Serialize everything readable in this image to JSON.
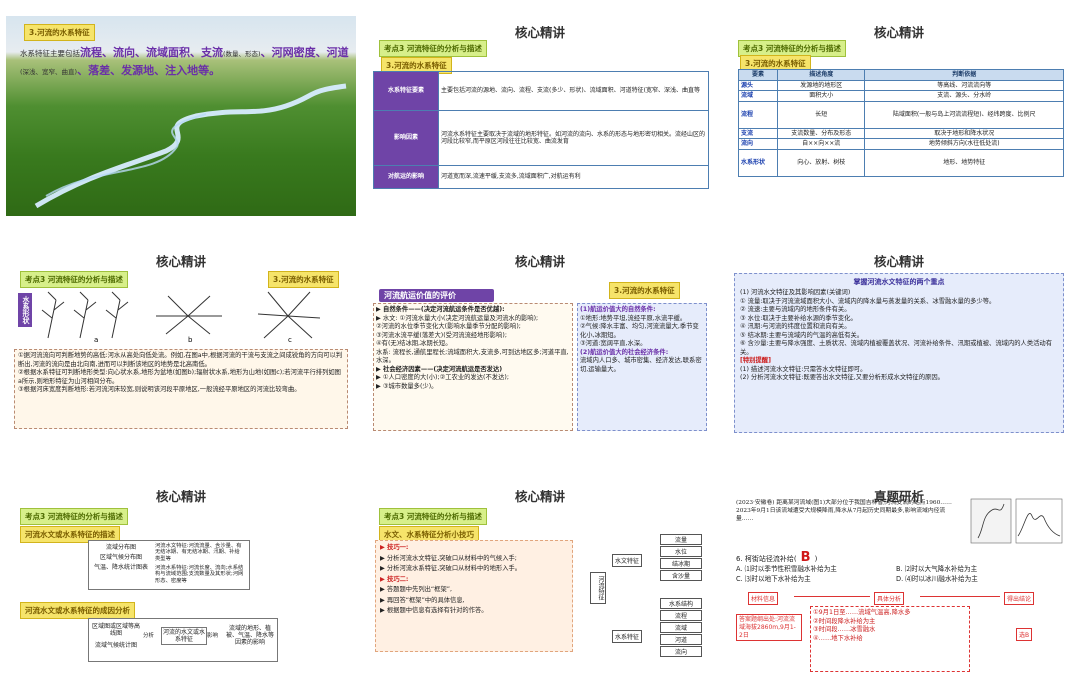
{
  "slides": {
    "s1": {
      "title": "3.河流的水系特征",
      "lead": "水系特征主要包括",
      "k1": "流程、流向、流域面积、支流",
      "k1note": "(数量、形态)",
      "k2": "、河网密度、河道",
      "k2note": "(深浅、宽窄、曲直)",
      "k3": "、落差、发源地、注入地等。"
    },
    "s2": {
      "title": "核心精讲",
      "tag": "考点3 河流特征的分析与描述",
      "subtag": "3.河流的水系特征",
      "rows": [
        {
          "h": "水系特征要素",
          "t": "主要包括河流的源地、流向、流程、支流(多少、形状)、流域面积、河道特征(宽窄、深浅、曲直等"
        },
        {
          "h": "影响因素",
          "t": "河流水系特征主要取决于流域的地形特征。如河流的流向、水系的形态与地形密切相关。流经山区的河段比较窄,而平原区河段往往比较宽、曲流发育"
        },
        {
          "h": "对航运的影响",
          "t": "河道宽而深,流速平缓,支流多,流域面积广,对航运有利"
        }
      ]
    },
    "s3": {
      "title": "核心精讲",
      "tag": "考点3 河流特征的分析与描述",
      "subtag": "3.河流的水系特征",
      "headers": [
        "要素",
        "描述角度",
        "判断依据"
      ],
      "rows": [
        [
          "源头",
          "发源地的地形区",
          "等高线、河流流向等"
        ],
        [
          "流域",
          "面积大小",
          "支流、源头、分水岭"
        ],
        [
          "流程",
          "长短",
          "陆域面积(一般与岛上河流流程短)、经纬跨度、比例尺"
        ],
        [
          "支流",
          "支流数量、分布及形态",
          "取决于地形和降水状况"
        ],
        [
          "流向",
          "自××向××流",
          "地势倾斜方向(水往低处流)"
        ],
        [
          "水系形状",
          "向心、放射、树枝",
          "地形、地势特征"
        ]
      ]
    },
    "s4": {
      "title": "核心精讲",
      "tag": "考点3 河流特征的分析与描述",
      "subtag": "3.河流的水系特征",
      "side": "水系形状",
      "labels": [
        "a",
        "b",
        "c"
      ],
      "b1": "①据河流流向可判断地势的高低:河水从高处向低处流。例如,在图a中,根据河流的干流与支流之间成锐角的方向可以判断出,河流的流向是由北向南,进而可以判断该地区的地势是北高南低。",
      "b2": "②根据水系特征可判断地形类型:向心状水系,地形为盆地(如图b);辐射状水系,地形为山地(如图c);若河流平行排列如图a所示,则地形特征为山河相间分布。",
      "b3": "③根据河床宽度判断地形:若河流河床较宽,则说明该河段平原地区,一般流经平原地区的河流比较弯曲。"
    },
    "s5": {
      "title": "核心精讲",
      "tag": "考点3 河流特征的分析与描述",
      "subtag": "3.河流的水系特征",
      "section": "河流航运价值的评价",
      "left": [
        "▶ 自然条件——(决定河流航运条件是否优越):",
        "▶ 水文: ①河流水量大小(决定河流航运量及河流水的影响);",
        "②河流的水位季节变化大(影响水量季节分配的影响);",
        "③河流水流平缓(落差大)(受河流流经地形影响);",
        "④有(无)结冰期,冰期长短。",
        "水系: 流程长,通航里程长;流域面积大,支流多,可到达地区多;河道平直,水深。",
        "▶ 社会经济因素——(决定河流航运是否发达)",
        "▶ ①人口密度的大(小);②工农业的发达(不发达);",
        "▶ ③城市数量多(少)。"
      ],
      "right": [
        "(1)航运价值大的自然条件:",
        "①地形:地势平坦,流经平原,水流平缓。",
        "②气候:降水丰富、均匀,河流流量大,季节变化小,冰期短。",
        "③河道:宽阔平直,水深。",
        "(2)航运价值大的社会经济条件:",
        "流域内人口多、城市密集、经济发达,联系密切,运输量大。"
      ]
    },
    "s6": {
      "title": "核心精讲",
      "heading": "掌握河流水文特征的两个重点",
      "items": [
        "(1) 河流水文特征及其影响因素(关键词)",
        "① 流量:取决于河流流域面积大小、流域内的降水量与蒸发量的关系、冰雪融水量的多少等。",
        "② 流速:主要与流域内的地形条件有关。",
        "③ 水位:取决于主要补给水源的季节变化。",
        "④ 汛期:与河流的纬度位置和流向有关。",
        "⑤ 结冰期:主要与流域内的气温的高低有关。",
        "⑥ 含沙量:主要与降水强度、土质状况、流域内植被覆盖状况、河流补给条件、汛期或植被、流域内的人类活动有关。",
        "[特别提醒]",
        "(1) 描述河流水文特征:只需答水文特征即可。",
        "(2) 分析河流水文特征:既要答出水文特征,又要分析形成水文特征的原因。"
      ]
    },
    "s7": {
      "title": "核心精讲",
      "tag": "考点3 河流特征的分析与描述",
      "b1": "河流水文或水系特征的描述",
      "b2": "河流水文或水系特征的成因分析",
      "d1l": [
        "流域分布图",
        "区域气候分布图",
        "气温、降水统计图表"
      ],
      "d1r": [
        "河流水文特征:河流流量、含沙量、有无结冰期、有无结冰期、汛期、补给类型等",
        "河流水系特征:河流长度、流向;水系结构与流域范围;支流数量及其形状;河网形态、密度等"
      ],
      "d2l": [
        "区域图或区域等高线图",
        "流域气候统计图"
      ],
      "d2m": "河流的水文或水系特征",
      "d2r": "流域的地形、植被、气温、降水等因素的影响",
      "arrow1": "分析",
      "arrow2": "影响"
    },
    "s8": {
      "title": "核心精讲",
      "tag": "考点3 河流特征的分析与描述",
      "section": "水文、水系特征分析小技巧",
      "lines": [
        "▶ 技巧一:",
        "▶ 分析河流水文特征,突破口从材料中的气候入手;",
        "▶ 分析河流水系特征,突破口从材料中的地形入手。",
        "▶ 技巧二:",
        "▶ 答题题中先列出“框架”,",
        "▶ 再回答“框架”中的具体信息,",
        "▶ 根据题中信息有选择有针对的作答。"
      ],
      "center": "河流特征",
      "hydro": "水文特征",
      "system": "水系特征",
      "hydro_items": [
        "流量",
        "水位",
        "结冰期",
        "含沙量"
      ],
      "system_items": [
        "水系结构",
        "流程",
        "流域",
        "河道",
        "流向"
      ]
    },
    "s9": {
      "title": "真题研析",
      "intro": "(2023·安徽卷) 距离某河流域(图1)大部分位于我国吉林省,河流支流的站点1960……2023年9月1日该流域遭受大规模降雨,降水从7月起历史同期最多,影响流域内径流量……",
      "question": "6. 柯街站径流补给(",
      "answer": "B",
      "question_end": ")",
      "opts": [
        "A. ⑴时以季节性积雪融水补给为主",
        "B. ⑵时以大气降水补给为主",
        "C. ⑶时以地下水补给为主",
        "D. ⑷时以冰川融水补给为主"
      ],
      "flow": [
        "材料信息",
        "具体分析",
        "得出结论"
      ],
      "notes": [
        "①9月1日至……流域气温高,降水多",
        "②时间段降水补给为主",
        "③时间段……冰雪融水",
        "④……地下水补给"
      ],
      "left_note": "答案题纲出处:河流流域海拔2860m,9月1-2日",
      "result": "选B"
    }
  },
  "colors": {
    "accent": "#6f44a7",
    "red": "#cc2020",
    "tag": "#f6e46a"
  }
}
